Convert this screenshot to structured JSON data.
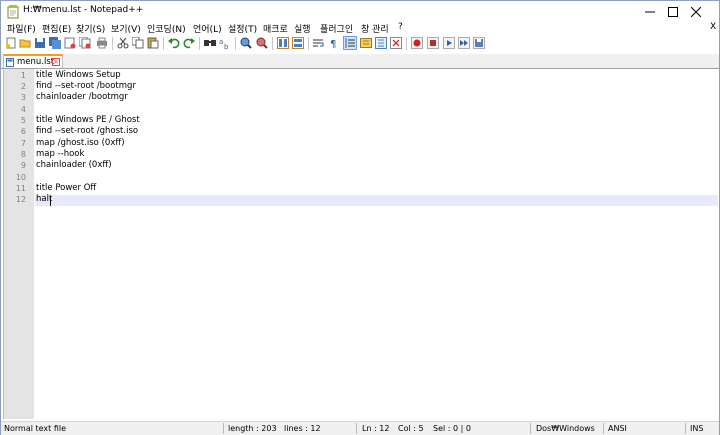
{
  "window": {
    "title": "H:₩menu.lst - Notepad++"
  },
  "menu": {
    "items": [
      "파일(F)",
      "편집(E)",
      "찾기(S)",
      "보기(V)",
      "인코딩(N)",
      "언어(L)",
      "설정(T)",
      "매크로",
      "실행",
      "플러그인",
      "창 관리",
      "?"
    ],
    "close_x": "X"
  },
  "toolbar": {
    "icons": [
      "new-file-icon",
      "open-icon",
      "save-icon",
      "save-all-icon",
      "close-icon",
      "close-all-icon",
      "print-icon",
      "cut-icon",
      "copy-icon",
      "paste-icon",
      "undo-icon",
      "redo-icon",
      "find-icon",
      "replace-icon",
      "zoom-in-icon",
      "zoom-out-icon",
      "sync-vertical-icon",
      "sync-horizontal-icon",
      "word-wrap-icon",
      "show-all-chars-icon",
      "indent-guide-icon",
      "document-map-icon",
      "function-list-icon",
      "folder-workspace-icon",
      "monitoring-icon",
      "record-macro-icon",
      "stop-macro-icon",
      "play-macro-icon",
      "run-macro-multiple-icon",
      "save-macro-icon"
    ]
  },
  "tab": {
    "label": "menu.lst"
  },
  "editor": {
    "lines": [
      "title Windows Setup",
      "find --set-root /bootmgr",
      "chainloader /bootmgr",
      "",
      "title Windows PE / Ghost",
      "find --set-root /ghost.iso",
      "map /ghost.iso (0xff)",
      "map --hook",
      "chainloader (0xff)",
      "",
      "title Power Off",
      "halt"
    ],
    "line_numbers": [
      "1",
      "2",
      "3",
      "4",
      "5",
      "6",
      "7",
      "8",
      "9",
      "10",
      "11",
      "12"
    ]
  },
  "status": {
    "file_type": "Normal text file",
    "length": "length : 203",
    "lines": "lines : 12",
    "ln": "Ln : 12",
    "col": "Col : 5",
    "sel": "Sel : 0 | 0",
    "eol": "Dos₩Windows",
    "encoding": "ANSI",
    "mode": "INS"
  },
  "colors": {
    "tab_accent": "#fa9a1e",
    "current_line": "#e8e8ff",
    "gutter": "#e4e4e4"
  }
}
